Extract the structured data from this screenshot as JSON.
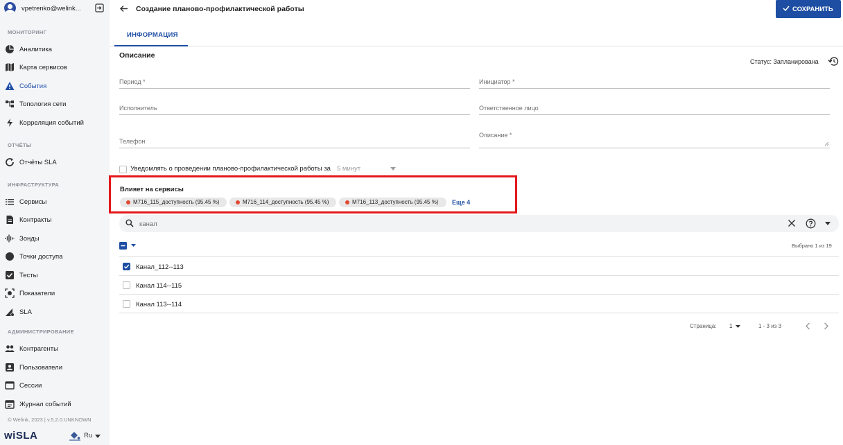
{
  "user": {
    "name": "vpetrenko@welink..."
  },
  "sidebar": {
    "sections": {
      "monitoring": "МОНИТОРИНГ",
      "reports": "ОТЧЁТЫ",
      "infrastructure": "ИНФРАСТРУКТУРА",
      "administration": "АДМИНИСТРИРОВАНИЕ"
    },
    "items": {
      "analytics": "Аналитика",
      "service_map": "Карта сервисов",
      "events": "События",
      "topology": "Топология сети",
      "correlation": "Корреляция событий",
      "sla_reports": "Отчёты SLA",
      "services": "Сервисы",
      "contracts": "Контракты",
      "probes": "Зонды",
      "access_points": "Точки доступа",
      "tests": "Тесты",
      "metrics": "Показатели",
      "sla": "SLA",
      "counterparties": "Контрагенты",
      "users": "Пользователи",
      "sessions": "Сессии",
      "event_log": "Журнал событий"
    },
    "active_color": "#1f4ea8",
    "footer": "© Welink, 2023 | v.5.2.0.UNKNOWN",
    "brand": "wiSLA",
    "language": "Ru"
  },
  "header": {
    "title": "Создание планово-профилактической работы",
    "save_label": "СОХРАНИТЬ",
    "accent": "#1e4ea3"
  },
  "tabs": {
    "info": "ИНФОРМАЦИЯ"
  },
  "form": {
    "section_title": "Описание",
    "status": "Статус: Запланирована",
    "period": "Период *",
    "initiator": "Инициатор *",
    "executor": "Исполнитель",
    "responsible": "Ответственное лицо",
    "phone": "Телефон",
    "description": "Описание *",
    "notify_text": "Уведомлять о проведении планово-профилактической работы за",
    "notify_value": "5 минут"
  },
  "affects": {
    "title": "Влияет на сервисы",
    "chips": [
      "M716_115_доступность (95.45 %)",
      "M716_114_доступность (95.45 %)",
      "M716_113_доступность (95.45 %)"
    ],
    "more": "Еще 4",
    "highlight_color": "#e3171b"
  },
  "search": {
    "value": "канал"
  },
  "list": {
    "selected_count": "Выбрано 1 из 19",
    "rows": [
      {
        "label": "Канал_112--113",
        "checked": true
      },
      {
        "label": "Канал 114--115",
        "checked": false
      },
      {
        "label": "Канал 113--114",
        "checked": false
      }
    ]
  },
  "pagination": {
    "page_label": "Страница:",
    "page": "1",
    "range": "1 - 3 из 3"
  }
}
